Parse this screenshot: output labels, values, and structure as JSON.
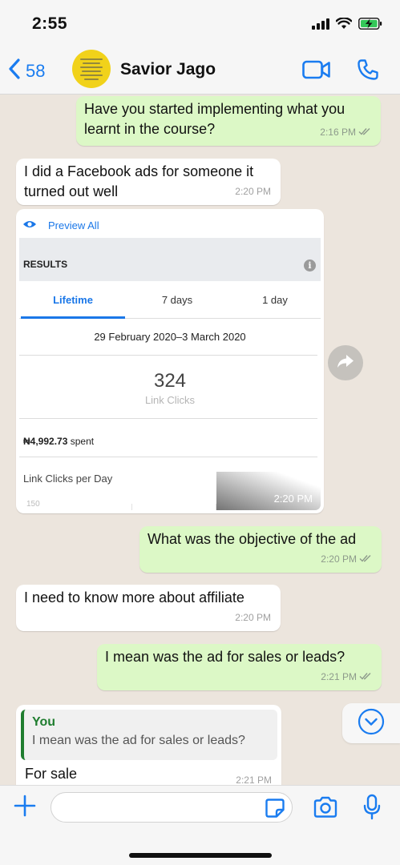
{
  "status_bar": {
    "time": "2:55"
  },
  "header": {
    "back_count": "58",
    "contact_name": "Savior Jago"
  },
  "messages": [
    {
      "direction": "outgoing",
      "text": "Have you started implementing what you learnt in the course?",
      "time": "2:16 PM",
      "read": true
    },
    {
      "direction": "incoming",
      "text": "I did a Facebook ads for someone it turned out well",
      "time": "2:20 PM"
    },
    {
      "direction": "incoming",
      "type": "image",
      "time": "2:20 PM"
    },
    {
      "direction": "outgoing",
      "text": "What was the objective of the ad",
      "time": "2:20 PM",
      "read": true
    },
    {
      "direction": "incoming",
      "text": "I need to know more about affiliate",
      "time": "2:20 PM"
    },
    {
      "direction": "outgoing",
      "text": "I mean was the ad for sales or leads?",
      "time": "2:21 PM",
      "read": true
    },
    {
      "direction": "incoming",
      "text": "For sale",
      "time": "2:21 PM",
      "quote": {
        "author": "You",
        "text": "I mean was the ad for sales or leads?"
      }
    }
  ],
  "fb_screenshot": {
    "preview_label": "Preview All",
    "section_title": "RESULTS",
    "info_icon": "i",
    "tabs": [
      "Lifetime",
      "7 days",
      "1 day"
    ],
    "active_tab": "Lifetime",
    "date_range": "29 February 2020–3 March 2020",
    "metric_value": "324",
    "metric_label": "Link Clicks",
    "spent_amount": "₦4,992.73",
    "spent_suffix": " spent",
    "chart_title": "Link Clicks per Day",
    "chart_axis_top": "150"
  },
  "composer": {
    "placeholder": ""
  },
  "icons": {
    "status": [
      "signal-icon",
      "wifi-icon",
      "battery-charging-icon"
    ],
    "header": [
      "back-chevron-icon",
      "video-call-icon",
      "phone-icon"
    ],
    "chat": [
      "forward-icon",
      "scroll-down-icon",
      "double-check-icon"
    ],
    "composer": [
      "plus-icon",
      "sticker-icon",
      "camera-icon",
      "microphone-icon"
    ]
  },
  "colors": {
    "accent": "#1a7cf0",
    "outgoing_bubble": "#dcf8c6",
    "incoming_bubble": "#ffffff",
    "chat_background": "#ece5dd",
    "quote_accent": "#1f7d2f",
    "facebook_blue": "#1a77e8"
  }
}
